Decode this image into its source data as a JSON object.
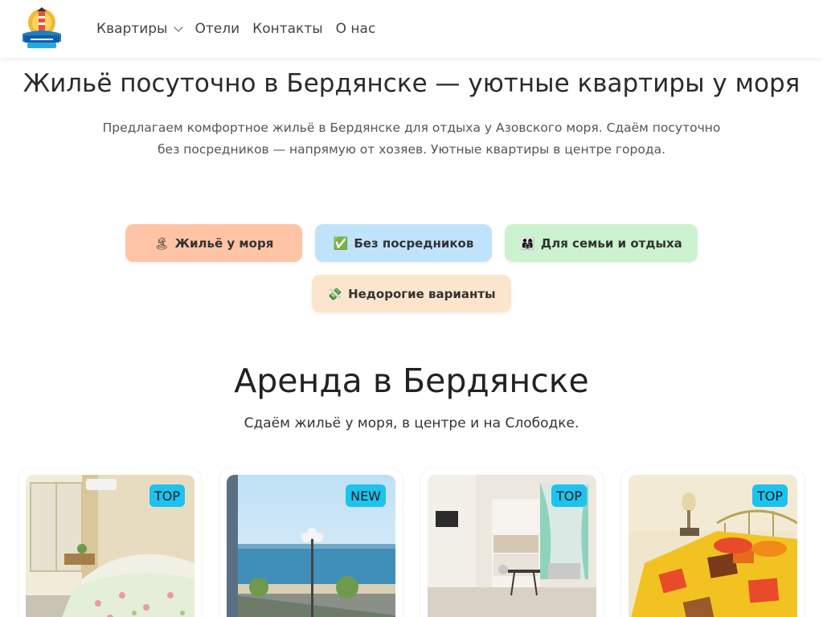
{
  "nav": {
    "items": [
      {
        "label": "Квартиры",
        "has_dropdown": true
      },
      {
        "label": "Отели"
      },
      {
        "label": "Контакты"
      },
      {
        "label": "О нас"
      }
    ]
  },
  "hero": {
    "title": "Жильё посуточно в Бердянске — уютные квартиры у моря",
    "subtitle": "Предлагаем комфортное жильё в Бердянске для отдыха у Азовского моря. Сдаём посуточно без посредников — напрямую от хозяев. Уютные квартиры в центре города."
  },
  "features": [
    {
      "emoji": "🏝",
      "label": "Жильё у моря",
      "color": "#ffc4a6"
    },
    {
      "emoji": "✅",
      "label": "Без посредников",
      "color": "#bfe3fb"
    },
    {
      "emoji": "👨‍👩‍👧",
      "label": "Для семьи и отдыха",
      "color": "#cdf2cf"
    },
    {
      "emoji": "💸",
      "label": "Недорогие варианты",
      "color": "#fbe6cd"
    }
  ],
  "rentals": {
    "title": "Аренда в Бердянске",
    "subtitle": "Сдаём жильё у моря, в центре и на Слободке.",
    "cards": [
      {
        "badge": "TOP"
      },
      {
        "badge": "NEW"
      },
      {
        "badge": "TOP"
      },
      {
        "badge": "TOP"
      }
    ]
  },
  "colors": {
    "badge": "#1ec2ef",
    "text": "#222222"
  }
}
